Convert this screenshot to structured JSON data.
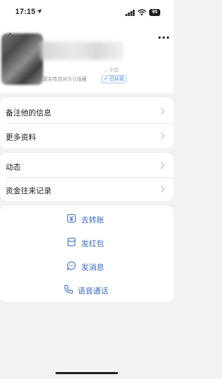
{
  "status_bar": {
    "time": "17:15",
    "battery": "95"
  },
  "profile": {
    "region": "，中国",
    "verify_text": "真实性由对方已隐藏",
    "verify_badge": "已认证"
  },
  "card1": {
    "rows": [
      {
        "label": "备注他的信息"
      },
      {
        "label": "更多资料"
      }
    ]
  },
  "card2": {
    "rows": [
      {
        "label": "动态"
      },
      {
        "label": "资金往来记录"
      }
    ]
  },
  "actions": [
    {
      "label": "去转账",
      "icon": "transfer-icon"
    },
    {
      "label": "发红包",
      "icon": "red-packet-icon"
    },
    {
      "label": "发消息",
      "icon": "message-icon"
    },
    {
      "label": "语音通话",
      "icon": "phone-icon"
    }
  ],
  "colors": {
    "accent": "#3a6bc2",
    "badge": "#3478f6",
    "background": "#f2f2f4"
  }
}
